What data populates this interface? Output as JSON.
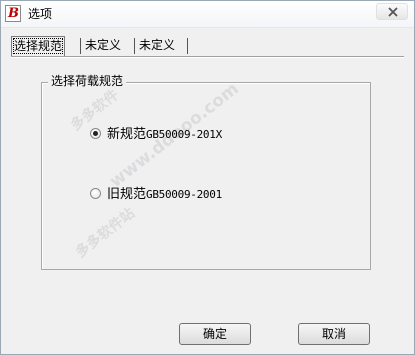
{
  "window": {
    "title": "选项",
    "app_icon": "app-logo-icon",
    "app_icon_letter": "B",
    "close_icon": "close-icon"
  },
  "tabs": [
    {
      "label": "选择规范",
      "active": true
    },
    {
      "label": "未定义",
      "active": false
    },
    {
      "label": "未定义",
      "active": false
    }
  ],
  "group": {
    "title": "选择荷载规范",
    "options": [
      {
        "main": "新规范",
        "code": "GB50009-201X",
        "checked": true
      },
      {
        "main": "旧规范",
        "code": "GB50009-2001",
        "checked": false
      }
    ]
  },
  "buttons": {
    "ok": "确定",
    "cancel": "取消"
  },
  "watermark": {
    "site": "www.ddooo.com",
    "text1": "多多软件",
    "text2": "多多软件站"
  }
}
